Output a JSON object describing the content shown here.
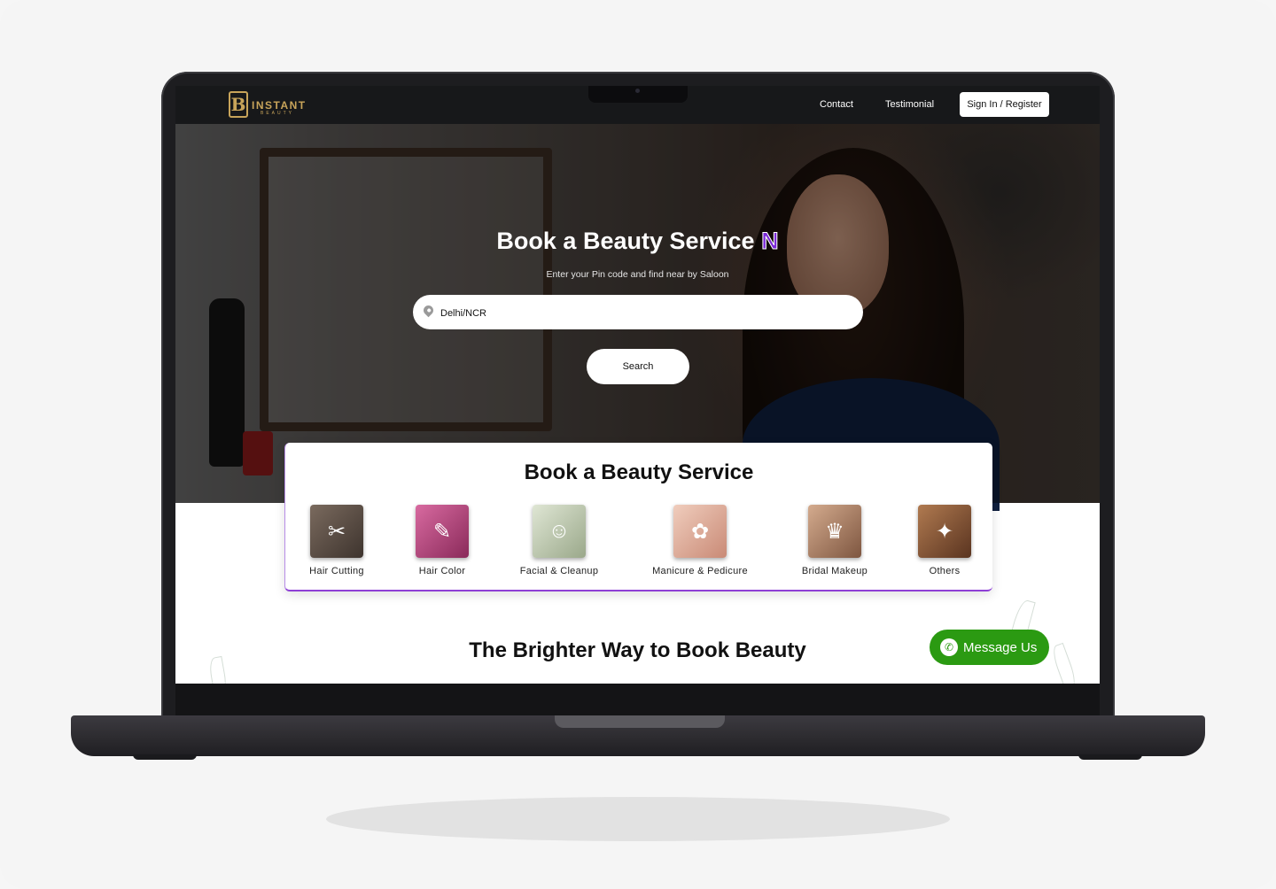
{
  "brand": {
    "logo_letter": "B",
    "name": "INSTANT",
    "tagline": "BEAUTY",
    "color": "#c8a45a"
  },
  "nav": {
    "contact": "Contact",
    "testimonial": "Testimonial",
    "signin": "Sign In / Register"
  },
  "hero": {
    "title": "Book a Beauty Service",
    "title_accent": "N",
    "subtitle": "Enter your Pin code and find near by Saloon",
    "search_value": "Delhi/NCR",
    "search_button": "Search"
  },
  "services": {
    "title": "Book a Beauty Service",
    "items": [
      {
        "label": "Hair Cutting",
        "icon": "scissors-icon",
        "color": "#5a4a40"
      },
      {
        "label": "Hair Color",
        "icon": "hair-dye-icon",
        "color": "#c0407a"
      },
      {
        "label": "Facial & Cleanup",
        "icon": "face-mask-icon",
        "color": "#b9c4a8"
      },
      {
        "label": "Manicure & Pedicure",
        "icon": "nail-icon",
        "color": "#e2b3a0"
      },
      {
        "label": "Bridal Makeup",
        "icon": "makeup-icon",
        "color": "#b68a6e"
      },
      {
        "label": "Others",
        "icon": "salon-icon",
        "color": "#8a5a3a"
      }
    ]
  },
  "section_title": "The Brighter Way to Book Beauty",
  "message_button": "Message Us",
  "accent_colors": {
    "purple": "#7b2ad8",
    "whatsapp_green": "#2b9a12"
  }
}
